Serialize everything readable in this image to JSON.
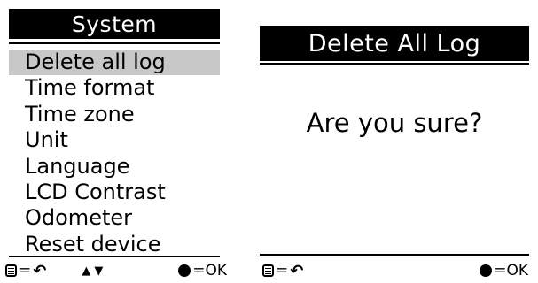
{
  "left_screen": {
    "title": "System",
    "menu_items": [
      {
        "label": "Delete all log",
        "selected": true
      },
      {
        "label": "Time format"
      },
      {
        "label": "Time zone"
      },
      {
        "label": "Unit"
      },
      {
        "label": "Language"
      },
      {
        "label": "LCD Contrast"
      },
      {
        "label": "Odometer"
      },
      {
        "label": "Reset device"
      }
    ],
    "footer": {
      "menu_icon": "menu-icon",
      "eq": "=",
      "back_icon": "back-arrow-icon",
      "back_glyph": "↶",
      "nav_arrows": "▲▼",
      "ok_icon": "filled-circle-icon",
      "ok_label": "=OK"
    }
  },
  "right_screen": {
    "title": "Delete All Log",
    "message": "Are you sure?",
    "footer": {
      "menu_icon": "menu-icon",
      "eq": "=",
      "back_icon": "back-arrow-icon",
      "back_glyph": "↶",
      "ok_icon": "filled-circle-icon",
      "ok_label": "=OK"
    }
  },
  "colors": {
    "background": "#ffffff",
    "title_bar": "#000000",
    "title_text": "#ffffff",
    "selection_highlight": "#c8c8c8"
  }
}
